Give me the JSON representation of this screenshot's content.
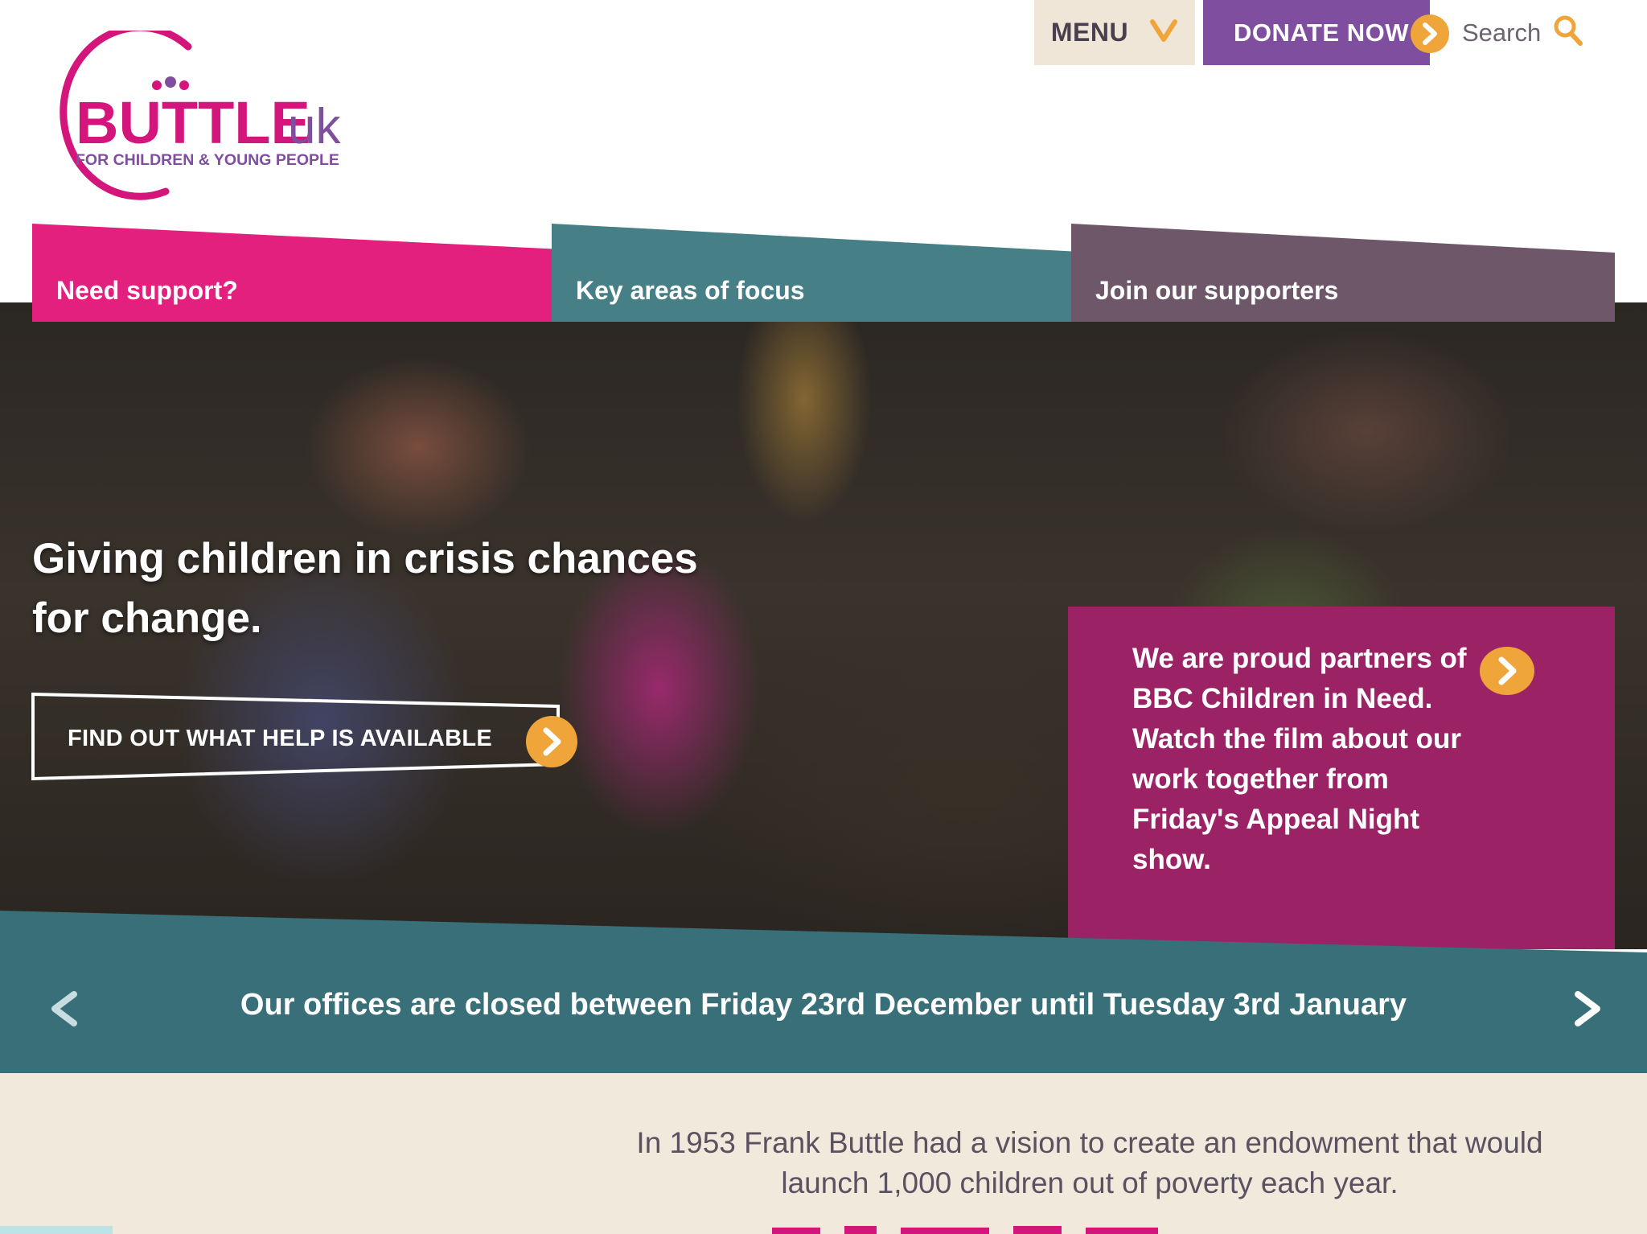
{
  "brand": {
    "name_main": "BUTTLE",
    "name_suffix": "uk",
    "tagline": "FOR CHILDREN & YOUNG PEOPLE"
  },
  "top_nav": {
    "menu_label": "MENU",
    "donate_label": "DONATE NOW",
    "search_label": "Search"
  },
  "tabs": [
    {
      "label": "Need support?",
      "color": "#e3207e"
    },
    {
      "label": "Key areas of focus",
      "color": "#467f86"
    },
    {
      "label": "Join our supporters",
      "color": "#6d5768"
    }
  ],
  "hero": {
    "headline": "Giving children in crisis chances for change.",
    "cta_label": "FIND OUT WHAT HELP IS AVAILABLE"
  },
  "promo": {
    "text": "We are proud partners of BBC Children in Need. Watch the film about our work together from Friday's Appeal Night show.",
    "color": "#9c2266"
  },
  "notice": {
    "text": "Our offices are closed between Friday 23rd December until Tuesday 3rd January",
    "color": "#386f78"
  },
  "intro": {
    "text": "In 1953 Frank Buttle had a vision to create an endowment that would launch 1,000 children out of poverty each year."
  },
  "colors": {
    "accent_orange": "#f0a53a",
    "magenta": "#d3157c",
    "purple": "#7f4e9e",
    "cream": "#f1e9dc"
  },
  "icons": {
    "menu": "chevron-down-icon",
    "donate": "arrow-right-circle-icon",
    "search": "search-icon",
    "prev": "chevron-left-icon",
    "next": "chevron-right-icon"
  }
}
